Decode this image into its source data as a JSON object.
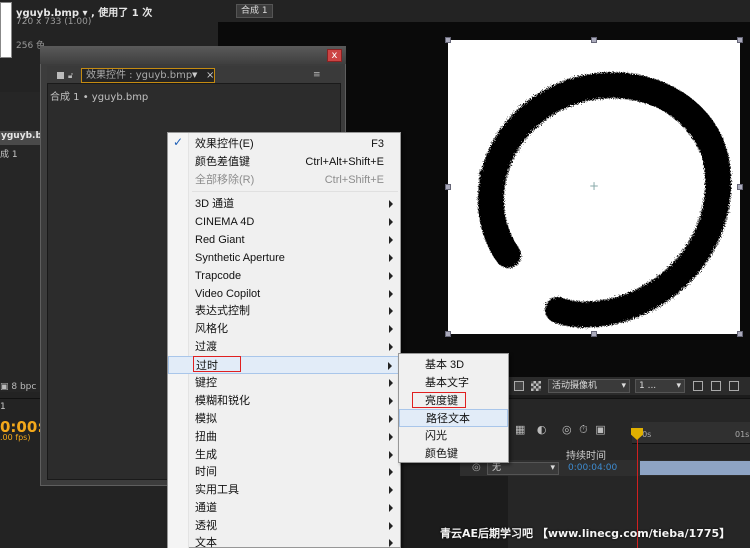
{
  "project": {
    "file_name": "yguyb.bmp ▾ , 使用了 1 次",
    "dimensions": "720 x 733 (1.00)",
    "colors": "256 色",
    "items": [
      "yguyb.bmp",
      "成 1"
    ],
    "bpc": "8 bpc"
  },
  "timeline": {
    "tab": "1",
    "timecode": "0:00:00",
    "fps": ".00 fps)",
    "duration_header": "持续时间",
    "parent_select": "无",
    "duration_value": "0:00:04:00",
    "ruler_start": "00s",
    "ruler_end": "01s"
  },
  "composition": {
    "tab": "合成 1",
    "stamp": "Ink art stamp",
    "camera_select": "活动摄像机",
    "views_select": "1 ..."
  },
  "effect_controls": {
    "tab_label": "效果控件 : yguyb.bmp",
    "close_glyph": "×",
    "window_close": "x",
    "breadcrumb": "合成 1 • yguyb.bmp"
  },
  "context_menu": {
    "items": [
      {
        "label": "效果控件(E)",
        "shortcut": "F3"
      },
      {
        "label": "颜色差值键",
        "shortcut": "Ctrl+Alt+Shift+E"
      },
      {
        "label": "全部移除(R)",
        "shortcut": "Ctrl+Shift+E"
      },
      {
        "label": "3D 通道"
      },
      {
        "label": "CINEMA 4D"
      },
      {
        "label": "Red Giant"
      },
      {
        "label": "Synthetic Aperture"
      },
      {
        "label": "Trapcode"
      },
      {
        "label": "Video Copilot"
      },
      {
        "label": "表达式控制"
      },
      {
        "label": "风格化"
      },
      {
        "label": "过渡"
      },
      {
        "label": "过时"
      },
      {
        "label": "键控"
      },
      {
        "label": "模糊和锐化"
      },
      {
        "label": "模拟"
      },
      {
        "label": "扭曲"
      },
      {
        "label": "生成"
      },
      {
        "label": "时间"
      },
      {
        "label": "实用工具"
      },
      {
        "label": "通道"
      },
      {
        "label": "透视"
      },
      {
        "label": "文本"
      }
    ]
  },
  "submenu": {
    "items": [
      "基本 3D",
      "基本文字",
      "亮度键",
      "路径文本",
      "闪光",
      "颜色键"
    ]
  },
  "watermark": "青云AE后期学习吧 【www.linecg.com/tieba/1775】",
  "colors": {
    "accent_orange": "#f3a81b",
    "highlight": "#e2ecf8",
    "red_annotation": "#e02020"
  }
}
